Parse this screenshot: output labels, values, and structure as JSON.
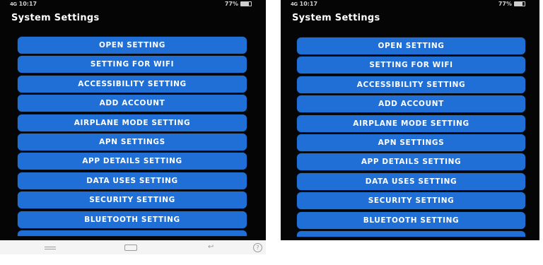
{
  "screens": [
    {
      "status": {
        "time": "10:17",
        "signal": "4G",
        "battery": "77%"
      },
      "title": "System Settings",
      "buttons": [
        "OPEN SETTING",
        "SETTING FOR WIFI",
        "ACCESSIBILITY SETTING",
        "ADD ACCOUNT",
        "AIRPLANE MODE SETTING",
        "APN SETTINGS",
        "APP DETAILS SETTING",
        "DATA USES SETTING",
        "SECURITY SETTING",
        "BLUETOOTH SETTING"
      ]
    },
    {
      "status": {
        "time": "10:17",
        "signal": "4G",
        "battery": "77%"
      },
      "title": "System Settings",
      "buttons": [
        "OPEN SETTING",
        "SETTING FOR WIFI",
        "ACCESSIBILITY SETTING",
        "ADD ACCOUNT",
        "AIRPLANE MODE SETTING",
        "APN SETTINGS",
        "APP DETAILS SETTING",
        "DATA USES SETTING",
        "SECURITY SETTING",
        "BLUETOOTH SETTING"
      ]
    }
  ],
  "nav_bar": {
    "back_glyph": "↩",
    "help_glyph": "?"
  },
  "colors": {
    "button": "#1f6fd6",
    "screen_background": "#050505",
    "title": "#ffffff"
  }
}
